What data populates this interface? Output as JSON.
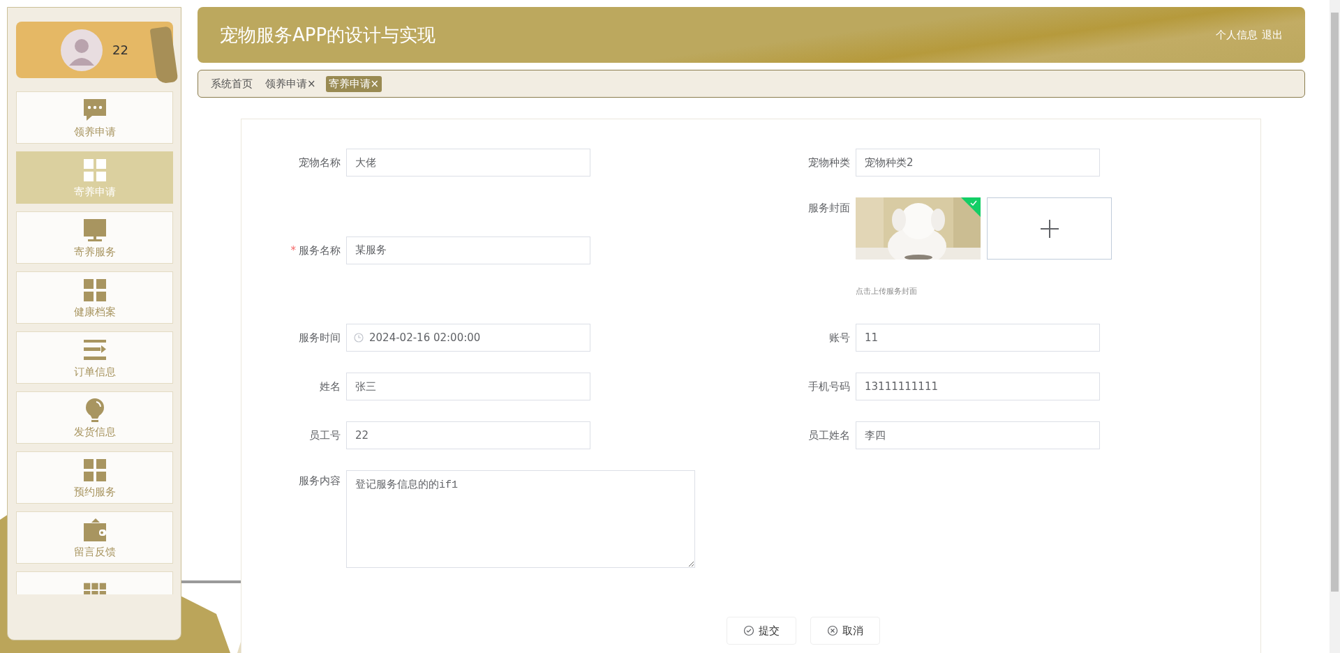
{
  "sidebar": {
    "profile": {
      "name": "22"
    },
    "items": [
      {
        "kind": "chat",
        "label": "领养申请",
        "selected": false
      },
      {
        "kind": "grid",
        "label": "寄养申请",
        "selected": true
      },
      {
        "kind": "monitor",
        "label": "寄养服务",
        "selected": false
      },
      {
        "kind": "grid",
        "label": "健康档案",
        "selected": false
      },
      {
        "kind": "list",
        "label": "订单信息",
        "selected": false
      },
      {
        "kind": "bulb",
        "label": "发货信息",
        "selected": false
      },
      {
        "kind": "grid",
        "label": "预约服务",
        "selected": false
      },
      {
        "kind": "wallet",
        "label": "留言反馈",
        "selected": false
      },
      {
        "kind": "apps",
        "selected": false
      }
    ]
  },
  "header": {
    "title": "宠物服务APP的设计与实现",
    "links": [
      "个人信息",
      "退出"
    ]
  },
  "tabs": [
    {
      "label": "系统首页",
      "selected": false
    },
    {
      "label": "领养申请",
      "close": "×",
      "selected": false
    },
    {
      "label": "寄养申请",
      "close": "×",
      "selected": true
    }
  ],
  "form": {
    "rows": [
      {
        "fields": [
          {
            "kind": "text",
            "label": "宠物名称",
            "value": "大佬"
          },
          {
            "kind": "text",
            "label": "宠物种类",
            "value": "宠物种类2"
          }
        ]
      },
      {
        "fields": [
          {
            "kind": "text",
            "label": "服务名称",
            "required_mark": "*",
            "value": "某服务"
          },
          {
            "kind": "upload",
            "label": "服务封面",
            "hint": "点击上传服务封面"
          }
        ]
      },
      {
        "fields": [
          {
            "kind": "datetime",
            "label": "服务时间",
            "value": "2024-02-16 02:00:00"
          },
          {
            "kind": "text",
            "label": "账号",
            "value": "11"
          }
        ]
      },
      {
        "fields": [
          {
            "kind": "text",
            "label": "姓名",
            "value": "张三"
          },
          {
            "kind": "text",
            "label": "手机号码",
            "value": "13111111111"
          }
        ]
      },
      {
        "fields": [
          {
            "kind": "text",
            "label": "员工号",
            "value": "22"
          },
          {
            "kind": "text",
            "label": "员工姓名",
            "value": "李四"
          }
        ]
      },
      {
        "fields": [
          {
            "kind": "textarea",
            "label": "服务内容",
            "value": "登记服务信息的的if1"
          }
        ]
      }
    ],
    "buttons": [
      {
        "kind": "submit",
        "label": "提交"
      },
      {
        "kind": "cancel",
        "label": "取消"
      }
    ]
  }
}
